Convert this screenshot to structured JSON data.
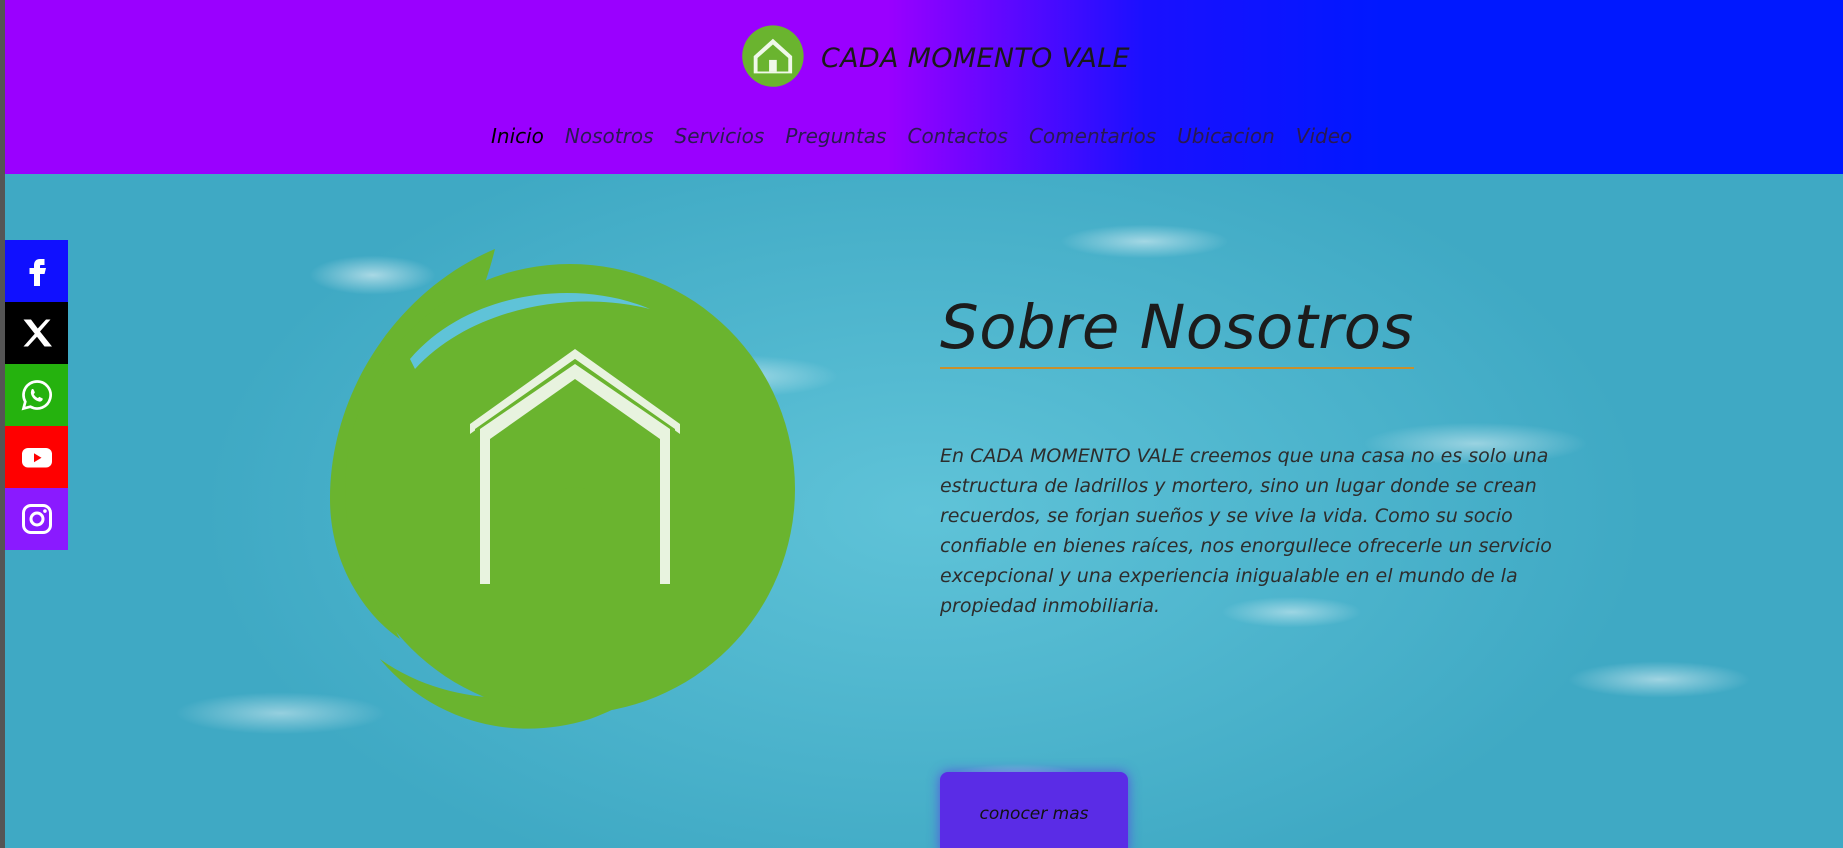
{
  "brand": {
    "name": "CADA MOMENTO VALE",
    "logo_icon": "house-swirl-logo-icon"
  },
  "colors": {
    "header_left": "#9a00ff",
    "header_right": "#0018ff",
    "logo_green": "#6ab42f",
    "button": "#5a2ce6",
    "title_underline": "#c8902c"
  },
  "nav": {
    "items": [
      "Inicio",
      "Nosotros",
      "Servicios",
      "Preguntas",
      "Contactos",
      "Comentarios",
      "Ubicacion",
      "Video"
    ],
    "active": "Inicio"
  },
  "about": {
    "title": "Sobre Nosotros",
    "text": "En CADA MOMENTO VALE creemos que una casa no es solo una estructura de ladrillos y mortero, sino un lugar donde se crean recuerdos, se forjan sueños y se vive la vida. Como su socio confiable en bienes raíces, nos enorgullece ofrecerle un servicio excepcional y una experiencia inigualable en el mundo de la propiedad inmobiliaria.",
    "button_label": "conocer mas"
  },
  "social": [
    {
      "name": "facebook",
      "icon": "facebook-icon",
      "color": "#1010ff"
    },
    {
      "name": "x",
      "icon": "x-icon",
      "color": "#000000"
    },
    {
      "name": "whatsapp",
      "icon": "whatsapp-icon",
      "color": "#25b20e"
    },
    {
      "name": "youtube",
      "icon": "youtube-icon",
      "color": "#ff0000"
    },
    {
      "name": "instagram",
      "icon": "instagram-icon",
      "color": "#8a1aff"
    }
  ]
}
